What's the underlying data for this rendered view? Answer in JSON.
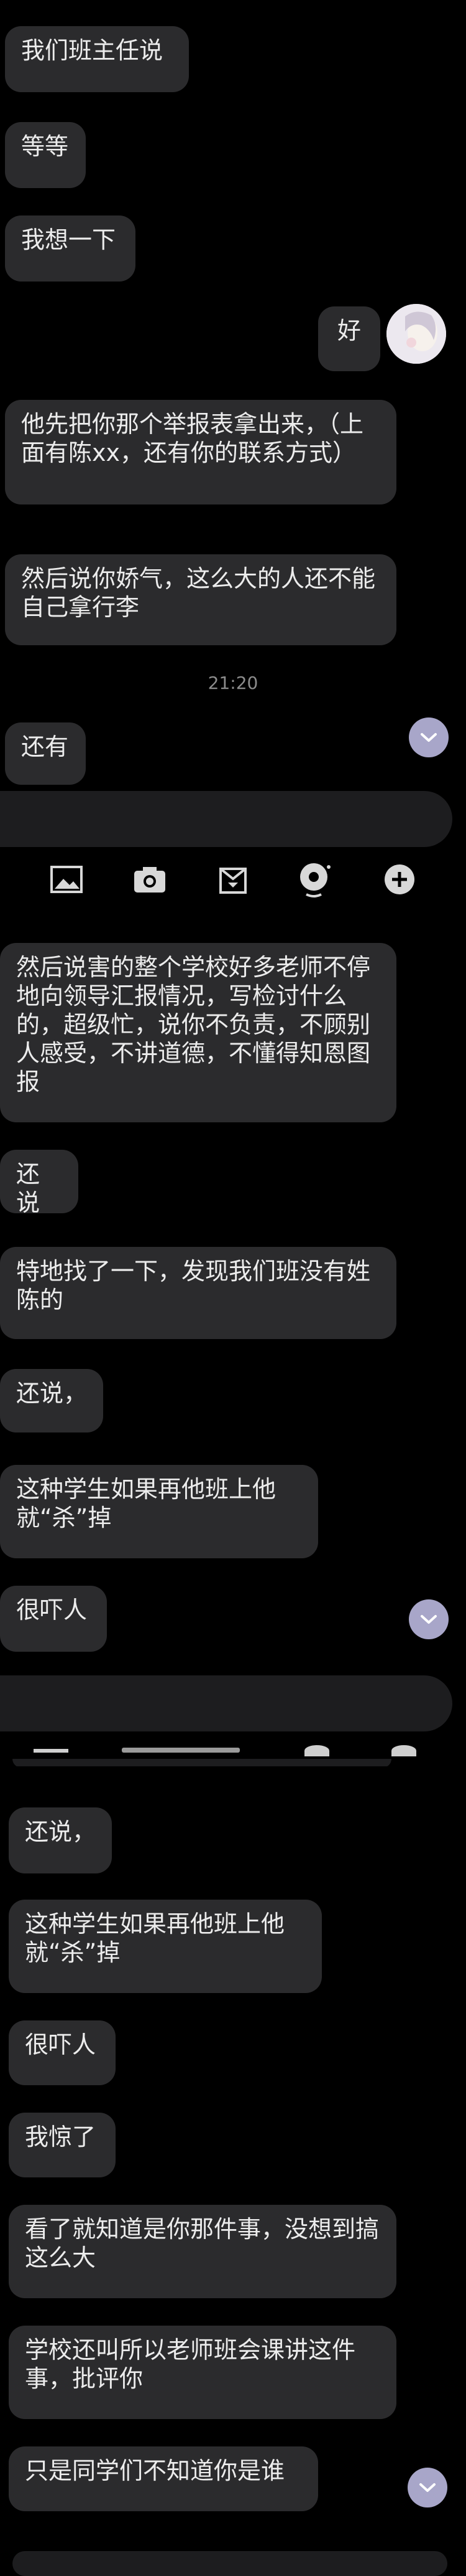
{
  "section1": {
    "messages": [
      {
        "text": "我们班主任说"
      },
      {
        "text": "等等"
      },
      {
        "text": "我想一下"
      },
      {
        "text": "好"
      },
      {
        "text": "他先把你那个举报表拿出来，（上面有陈xx，还有你的联系方式）"
      },
      {
        "text": "然后说你娇气，这么大的人还不能自己拿行李"
      }
    ],
    "time": "21:20",
    "last": "还有"
  },
  "toolbar": {
    "icons": [
      "image-icon",
      "camera-icon",
      "gift-box-icon",
      "sticker-icon",
      "plus-icon"
    ]
  },
  "section2": {
    "messages": [
      {
        "text": "然后说害的整个学校好多老师不停地向领导汇报情况，写检讨什么的，超级忙，说你不负责，不顾别人感受，不讲道德，不懂得知恩图报"
      },
      {
        "text": "还说"
      },
      {
        "text": "特地找了一下，发现我们班没有姓陈的"
      },
      {
        "text": "还说，"
      },
      {
        "text": "这种学生如果再他班上他就“杀”掉"
      },
      {
        "text": "很吓人"
      }
    ]
  },
  "section3": {
    "messages": [
      {
        "text": "还说，"
      },
      {
        "text": "这种学生如果再他班上他就“杀”掉"
      },
      {
        "text": "很吓人"
      },
      {
        "text": "我惊了"
      },
      {
        "text": "看了就知道是你那件事，没想到搞这么大"
      },
      {
        "text": "学校还叫所以老师班会课讲这件事，批评你"
      },
      {
        "text": "只是同学们不知道你是谁"
      }
    ]
  },
  "colors": {
    "bubble": "#2b2b2d",
    "background": "#000000",
    "scroll_button": "#a8a6c9"
  }
}
